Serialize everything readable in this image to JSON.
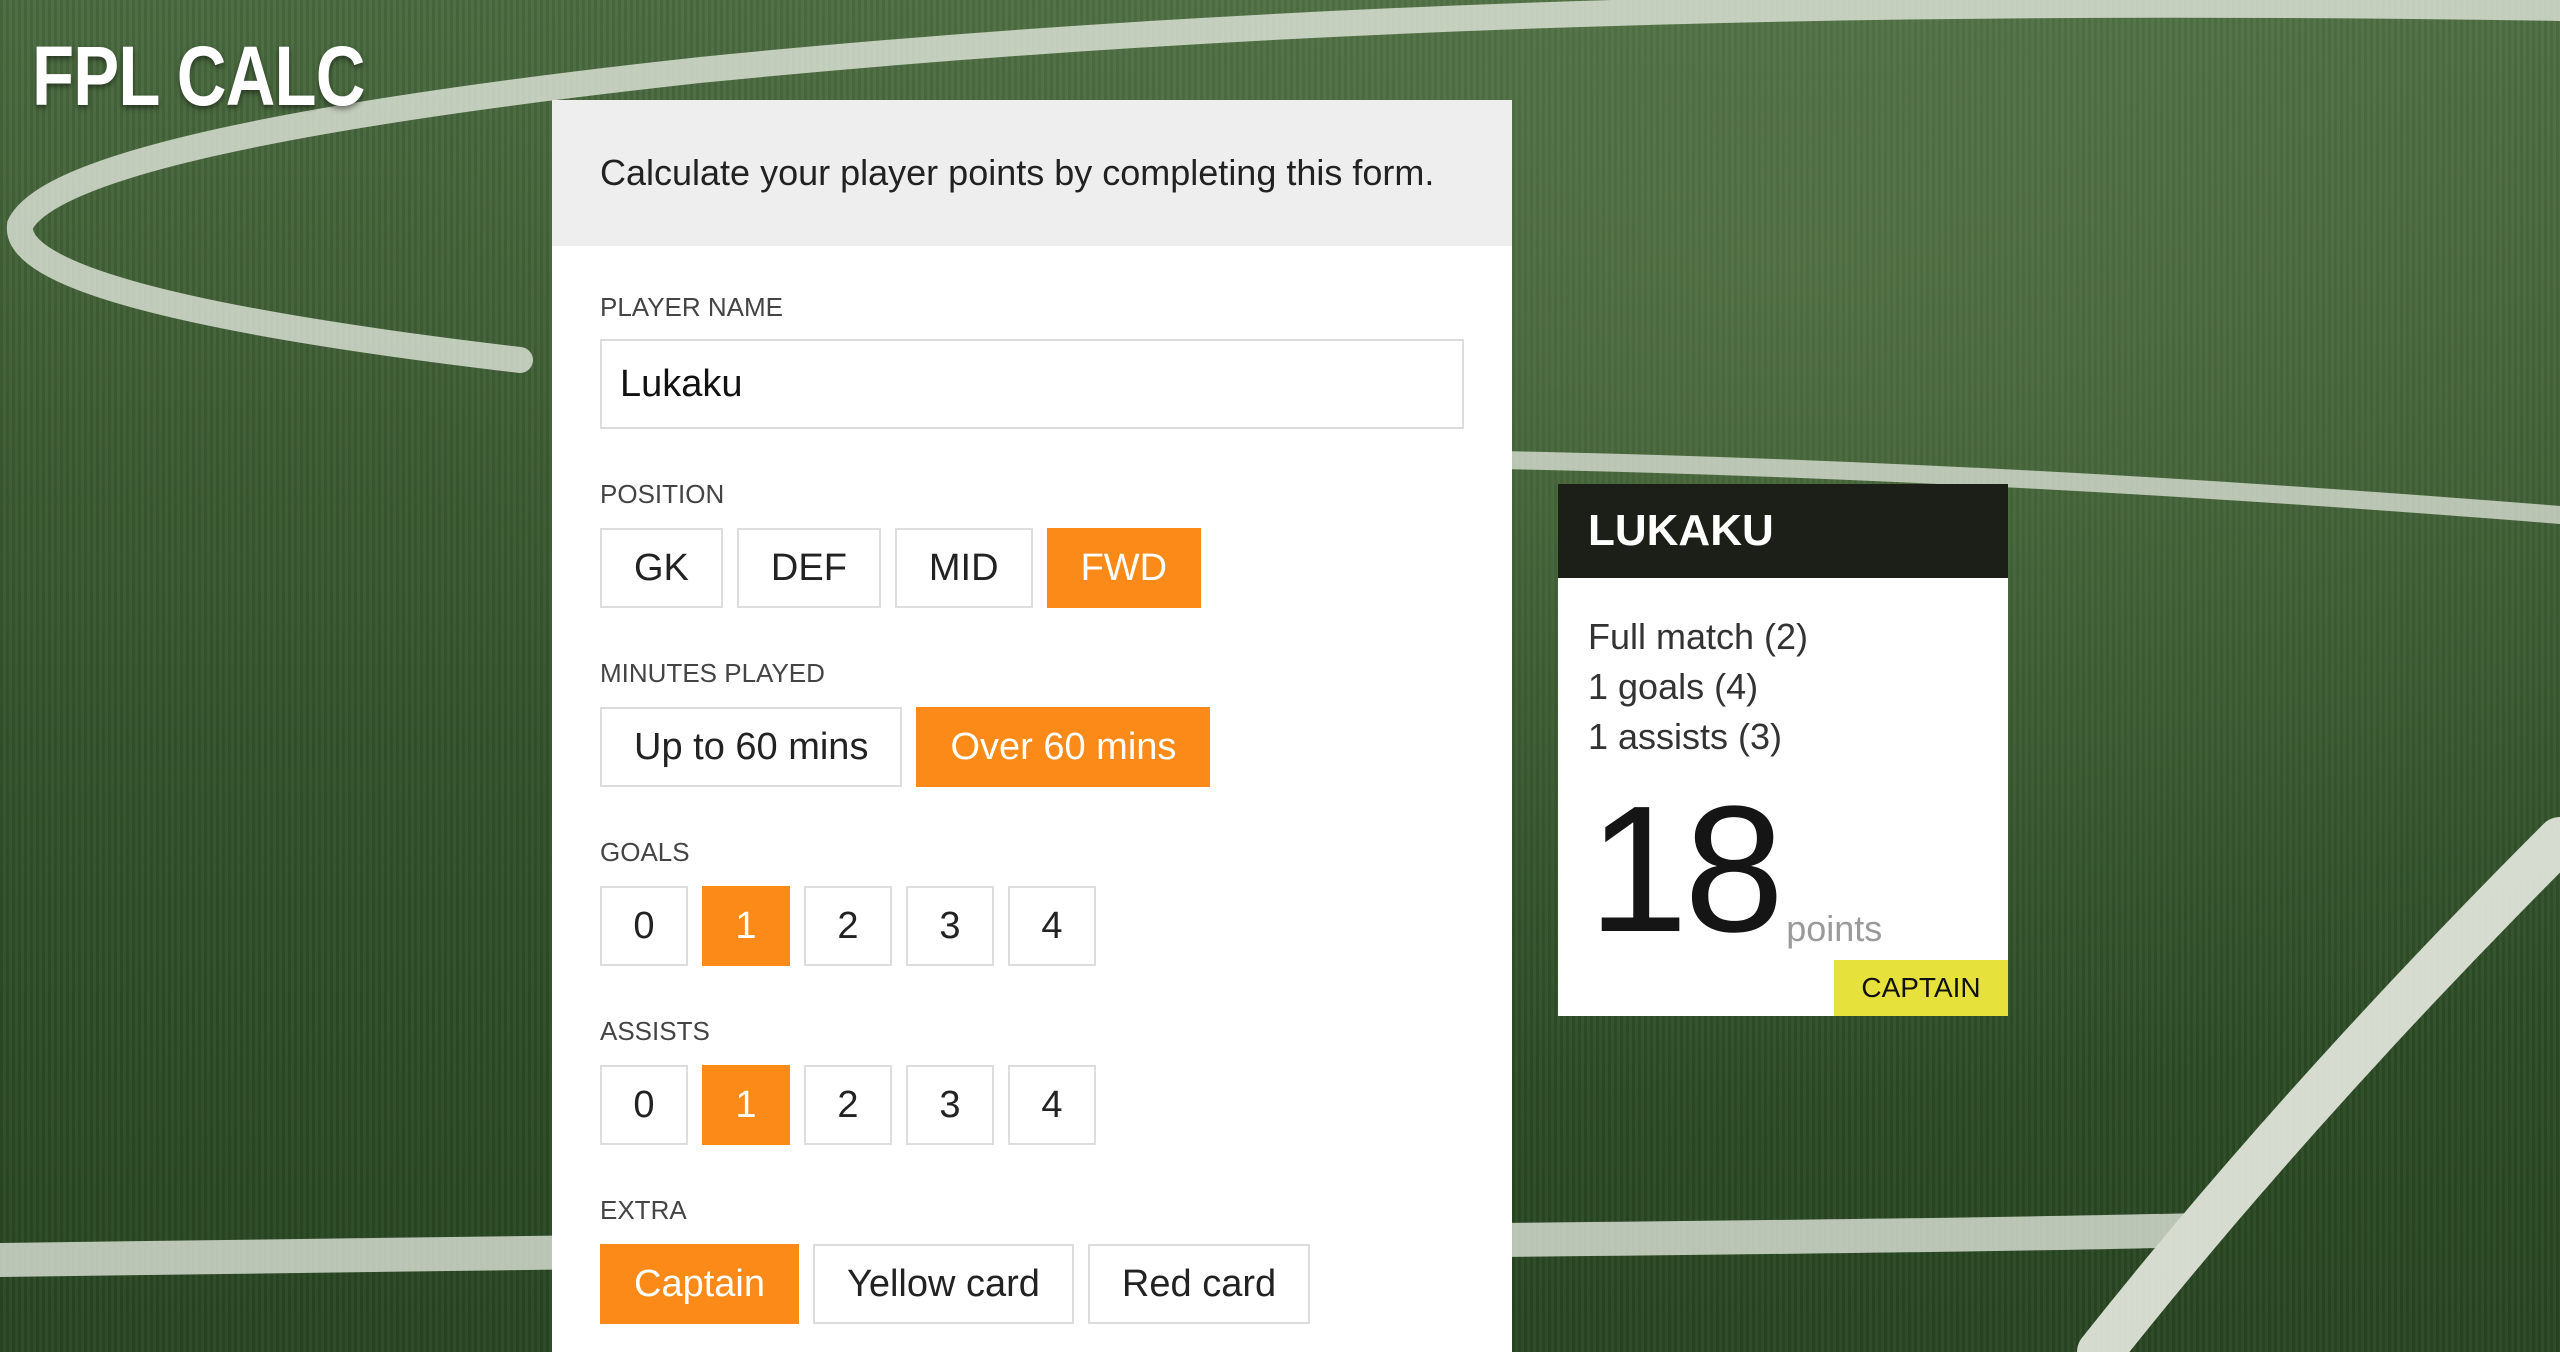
{
  "app": {
    "logo": "FPL CALC"
  },
  "form": {
    "intro": "Calculate your player points by completing this form.",
    "player_name": {
      "label": "PLAYER NAME",
      "value": "Lukaku"
    },
    "position": {
      "label": "POSITION",
      "options": [
        "GK",
        "DEF",
        "MID",
        "FWD"
      ],
      "selected": "FWD"
    },
    "minutes": {
      "label": "MINUTES PLAYED",
      "options": [
        "Up to 60 mins",
        "Over 60 mins"
      ],
      "selected": "Over 60 mins"
    },
    "goals": {
      "label": "GOALS",
      "options": [
        "0",
        "1",
        "2",
        "3",
        "4"
      ],
      "selected": "1"
    },
    "assists": {
      "label": "ASSISTS",
      "options": [
        "0",
        "1",
        "2",
        "3",
        "4"
      ],
      "selected": "1"
    },
    "extra": {
      "label": "EXTRA",
      "options": [
        "Captain",
        "Yellow card",
        "Red card"
      ],
      "selected": "Captain"
    }
  },
  "result": {
    "player": "LUKAKU",
    "lines": [
      "Full match (2)",
      "1 goals (4)",
      "1 assists (3)"
    ],
    "total": "18",
    "unit": "points",
    "badge": "CAPTAIN"
  },
  "colors": {
    "accent": "#fb8a18",
    "card_header": "#1b1f18",
    "badge": "#e7e23b",
    "panel_head": "#eeeeee"
  }
}
